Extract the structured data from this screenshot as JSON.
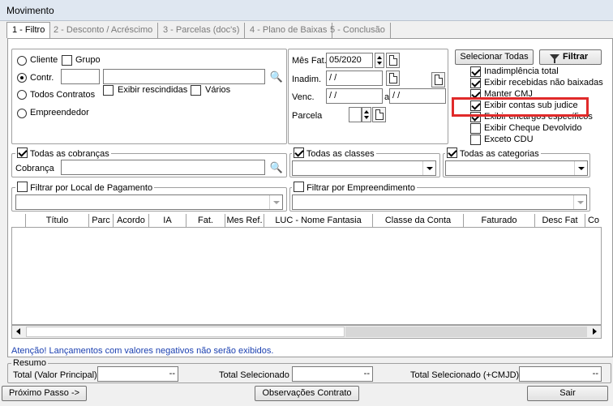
{
  "window": {
    "title": "Movimento"
  },
  "tabs": [
    {
      "label": "1 - Filtro"
    },
    {
      "label": "2 - Desconto / Acréscimo"
    },
    {
      "label": "3 - Parcelas (doc's)"
    },
    {
      "label": "4 - Plano de Baixas"
    },
    {
      "label": "5 - Conclusão"
    }
  ],
  "left_group": {
    "cliente": "Cliente",
    "grupo": "Grupo",
    "contr": "Contr.",
    "exibir_rescindidas": "Exibir rescindidas",
    "varios": "Vários",
    "todos_contratos": "Todos Contratos",
    "empreendedor": "Empreendedor"
  },
  "dates_group": {
    "mes_fat_label": "Mês Fat.",
    "mes_fat_value": "05/2020",
    "inadim_label": "Inadim.",
    "inadim_value": "/ /",
    "venc_label": "Venc.",
    "venc_from": "/ /",
    "venc_sep": "a",
    "venc_to": "/ /",
    "parcela_label": "Parcela"
  },
  "right_panel": {
    "select_all": "Selecionar Todas",
    "filter": "Filtrar",
    "options": [
      {
        "label": "Inadimplência total",
        "checked": true
      },
      {
        "label": "Exibir recebidas não baixadas",
        "checked": true
      },
      {
        "label": "Manter CMJ",
        "checked": true
      },
      {
        "label": "Exibir contas sub judice",
        "checked": true
      },
      {
        "label": "Exibir encargos específicos",
        "checked": true
      },
      {
        "label": "Exibir Cheque Devolvido",
        "checked": false
      },
      {
        "label": "Exceto CDU",
        "checked": false
      }
    ]
  },
  "cobrancas": {
    "legend": "Todas as cobranças",
    "field_label": "Cobrança"
  },
  "classes": {
    "legend": "Todas as classes"
  },
  "categorias": {
    "legend": "Todas as categorias"
  },
  "local_pagamento": {
    "legend": "Filtrar por Local de Pagamento"
  },
  "empreendimento": {
    "legend": "Filtrar por Empreendimento"
  },
  "table": {
    "columns": [
      "",
      "Título",
      "Parc",
      "Acordo",
      "IA",
      "Fat.",
      "Mes Ref.",
      "LUC - Nome Fantasia",
      "Classe da Conta",
      "Faturado",
      "Desc Fat",
      "Co"
    ]
  },
  "warning": "Atenção! Lançamentos com valores negativos não serão exibidos.",
  "resumo": {
    "legend": "Resumo",
    "total_principal": "Total (Valor Principal)",
    "total_selecionado": "Total Selecionado",
    "total_selecionado_cmjd": "Total Selecionado (+CMJD)",
    "empty_value": "--"
  },
  "footer": {
    "proximo": "Próximo Passo ->",
    "observacoes": "Observações Contrato",
    "sair": "Sair"
  },
  "colors": {
    "highlight": "#e02a2a",
    "warning_text": "#1a3fb0"
  }
}
